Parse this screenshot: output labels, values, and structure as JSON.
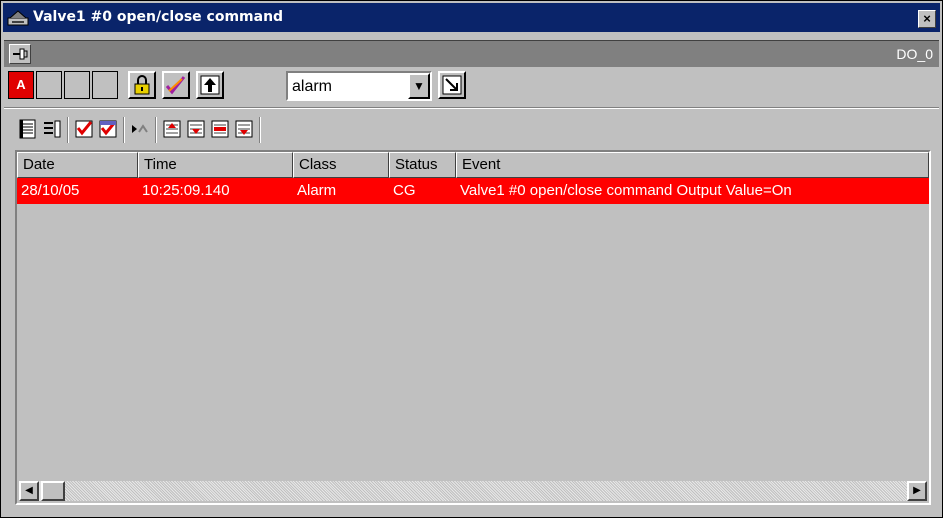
{
  "window": {
    "title": "Valve1 #0 open/close command",
    "close_label": "×"
  },
  "toolbar_top": {
    "right_label": "DO_0"
  },
  "filters": {
    "alarm_badge": "A",
    "combo_value": "alarm",
    "combo_options": [
      "alarm"
    ]
  },
  "icons": {
    "app": "valve-icon",
    "pin": "pin-icon",
    "lock": "lock-icon",
    "ack": "acknowledge-icon",
    "up": "arrow-up-icon",
    "popout": "popout-icon",
    "list_view": "list-view-icon",
    "detail_view": "detail-view-icon",
    "check1": "check-red-icon",
    "check2": "check-red-icon",
    "navigate": "navigate-icon",
    "first": "first-record-icon",
    "prev": "previous-record-icon",
    "next": "next-record-icon",
    "last": "last-record-icon"
  },
  "table": {
    "columns": [
      "Date",
      "Time",
      "Class",
      "Status",
      "Event"
    ],
    "rows": [
      {
        "date": "28/10/05",
        "time": "10:25:09.140",
        "class": "Alarm",
        "status": "CG",
        "event": "Valve1 #0 open/close command Output Value=On"
      }
    ]
  },
  "colors": {
    "titlebar": "#0a246a",
    "selected_row": "#ff0000",
    "alarm_badge": "#e00000"
  }
}
